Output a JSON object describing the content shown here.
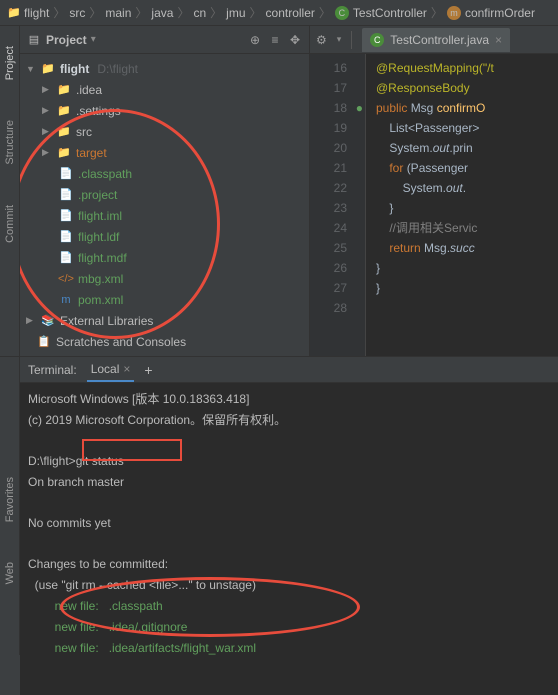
{
  "breadcrumb": [
    "flight",
    "src",
    "main",
    "java",
    "cn",
    "jmu",
    "controller"
  ],
  "breadcrumb_class": "TestController",
  "breadcrumb_method": "confirmOrder",
  "project": {
    "title": "Project",
    "root": "flight",
    "root_path": "D:\\flight",
    "folders": [
      ".idea",
      ".settings",
      "src",
      "target"
    ],
    "files": [
      ".classpath",
      ".project",
      "flight.iml",
      "flight.ldf",
      "flight.mdf",
      "mbg.xml",
      "pom.xml"
    ],
    "external": "External Libraries",
    "scratches": "Scratches and Consoles"
  },
  "rail": {
    "project": "Project",
    "structure": "Structure",
    "commit": "Commit",
    "favorites": "Favorites",
    "web": "Web"
  },
  "editor": {
    "tab": "TestController.java",
    "lines": [
      "16",
      "17",
      "18",
      "19",
      "20",
      "21",
      "22",
      "23",
      "24",
      "25",
      "26",
      "27",
      "28"
    ],
    "code": {
      "l16": "@RequestMapping(\"/t",
      "l17": "@ResponseBody",
      "l18a": "public ",
      "l18b": "Msg ",
      "l18c": "confirmO",
      "l19a": "List<",
      "l19b": "Passenger",
      "l19c": ">",
      "l20a": "System.",
      "l20b": "out",
      "l20c": ".prin",
      "l21a": "for ",
      "l21b": "(Passenger",
      "l22a": "System.",
      "l22b": "out",
      "l22c": ".",
      "l23": "}",
      "l24": "//调用相关Servic",
      "l25a": "return ",
      "l25b": "Msg.",
      "l25c": "succ",
      "l26": "}",
      "l27": "}"
    }
  },
  "terminal": {
    "label": "Terminal:",
    "tab": "Local",
    "lines": {
      "l1": "Microsoft Windows [版本 10.0.18363.418]",
      "l2": "(c) 2019 Microsoft Corporation。保留所有权利。",
      "l3": "D:\\flight>",
      "cmd": "git status",
      "l4": "On branch master",
      "l5": "No commits yet",
      "l6": "Changes to be committed:",
      "l7": "  (use \"git rm --cached <file>...\" to unstage)",
      "g1": "        new file:   .classpath",
      "g2": "        new file:   .idea/.gitignore",
      "g3": "        new file:   .idea/artifacts/flight_war.xml"
    }
  }
}
